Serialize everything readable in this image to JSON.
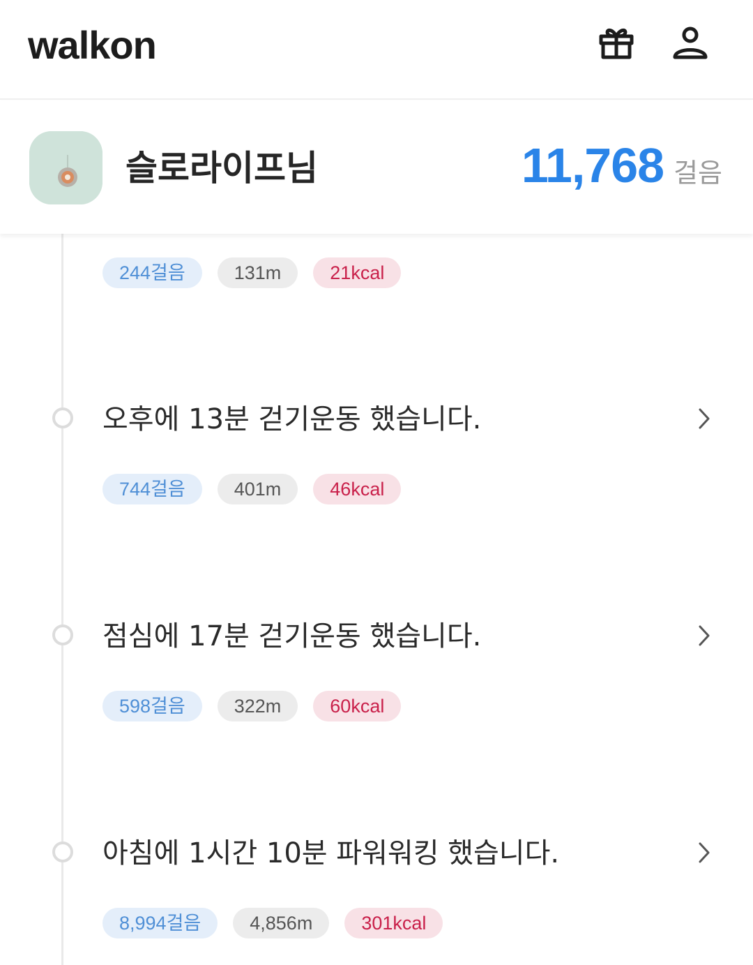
{
  "header": {
    "logo_text": "walkon",
    "gift_icon": "gift-icon",
    "user_icon": "user-icon"
  },
  "profile": {
    "name": "슬로라이프님",
    "total_steps": "11,768",
    "steps_unit": "걸음"
  },
  "activities": [
    {
      "title": "",
      "steps": "244걸음",
      "distance": "131m",
      "kcal": "21kcal"
    },
    {
      "title": "오후에 13분 걷기운동 했습니다.",
      "steps": "744걸음",
      "distance": "401m",
      "kcal": "46kcal"
    },
    {
      "title": "점심에 17분 걷기운동 했습니다.",
      "steps": "598걸음",
      "distance": "322m",
      "kcal": "60kcal"
    },
    {
      "title": "아침에 1시간 10분 파워워킹 했습니다.",
      "steps": "8,994걸음",
      "distance": "4,856m",
      "kcal": "301kcal"
    }
  ],
  "colors": {
    "accent_blue": "#2a84e8",
    "steps_chip_text": "#4f8fd6",
    "kcal_chip_text": "#c9204a"
  }
}
